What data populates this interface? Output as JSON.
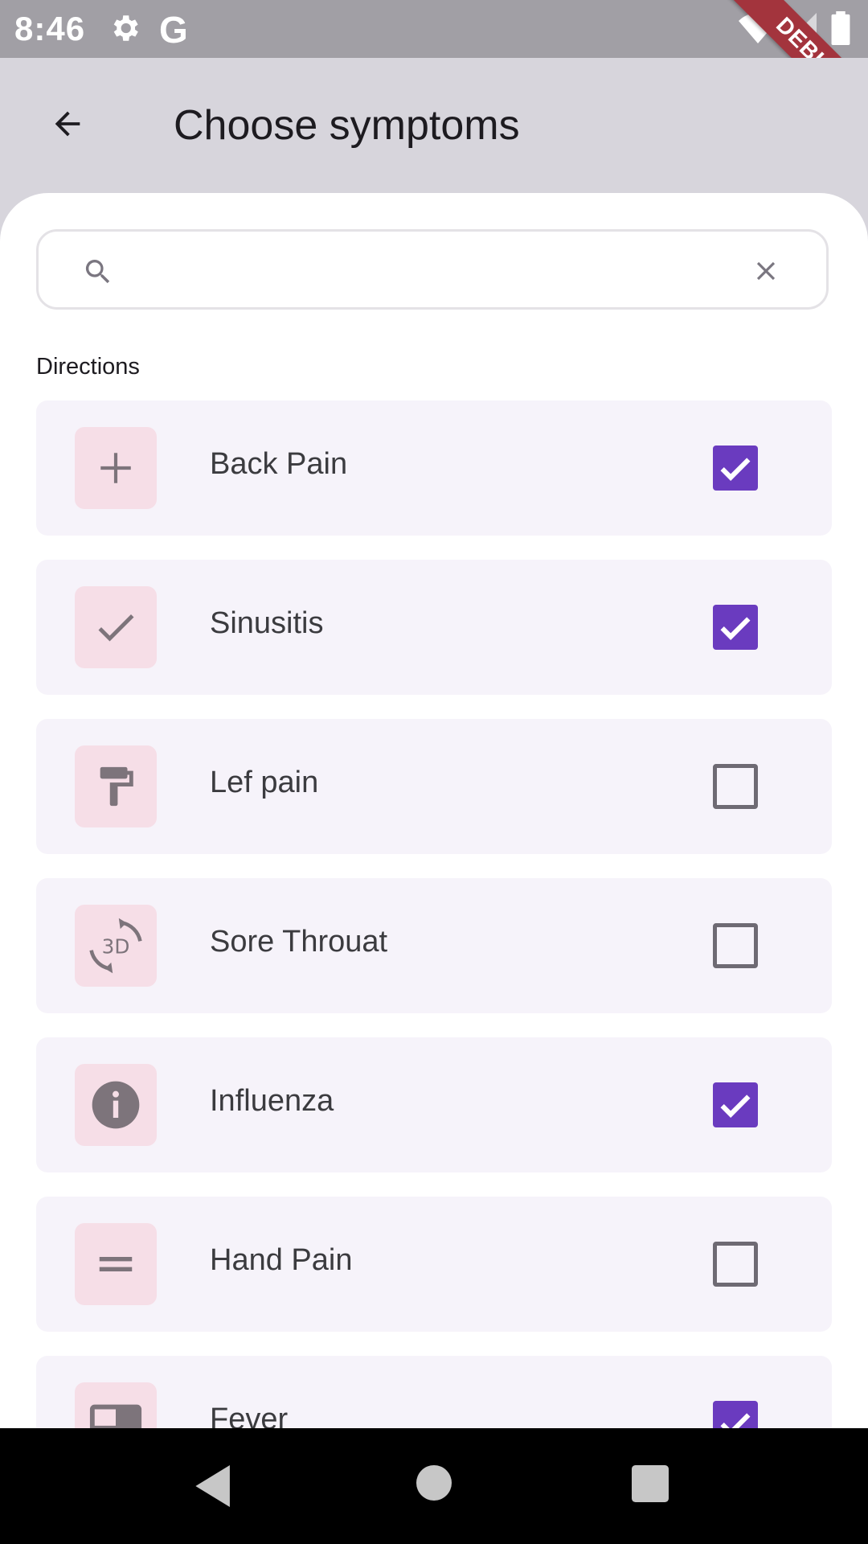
{
  "status_bar": {
    "time": "8:46",
    "icons": [
      "gear-icon",
      "google-icon",
      "wifi-icon",
      "signal-icon",
      "battery-icon"
    ],
    "debug_label": "DEBUG"
  },
  "app_bar": {
    "back_icon": "arrow-back-icon",
    "title": "Choose symptoms"
  },
  "search": {
    "placeholder": "",
    "value": "",
    "search_icon": "search-icon",
    "clear_icon": "close-icon"
  },
  "section_label": "Directions",
  "symptoms": [
    {
      "label": "Back Pain",
      "icon": "plus-icon",
      "checked": true
    },
    {
      "label": "Sinusitis",
      "icon": "check-icon",
      "checked": true
    },
    {
      "label": "Lef pain",
      "icon": "paint-roller-icon",
      "checked": false
    },
    {
      "label": "Sore Throuat",
      "icon": "3d-rotation-icon",
      "checked": false
    },
    {
      "label": "Influenza",
      "icon": "info-icon",
      "checked": true
    },
    {
      "label": "Hand Pain",
      "icon": "equals-icon",
      "checked": false
    },
    {
      "label": "Fever",
      "icon": "featured-video-icon",
      "checked": true
    }
  ],
  "colors": {
    "accent": "#6a3bbf",
    "icon_bg": "#f6dee7",
    "item_bg": "#f6f3fa",
    "app_bar_bg": "#d7d5dc"
  },
  "nav_bar": {
    "back": "nav-back-icon",
    "home": "nav-home-icon",
    "recents": "nav-recents-icon"
  }
}
